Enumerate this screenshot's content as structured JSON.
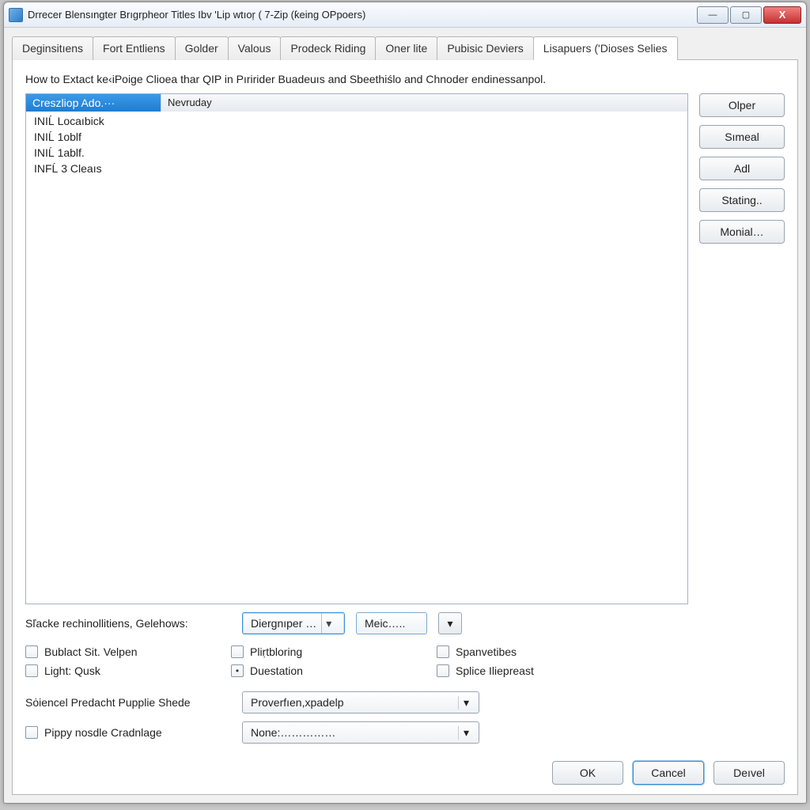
{
  "window": {
    "title": "Drrecer Blensıngter Brıgrpheor Titles Ibv 'Lip wtıoŗ ( 7-Zip (ƙeing OPpoers)"
  },
  "tabs": [
    "Deginsitıens",
    "Fort Entliens",
    "Golder",
    "Valous",
    "Prodeck Riding",
    "Oner lite",
    "Pubisic Deviers",
    "Lisapuers ('Dioses Selies"
  ],
  "active_tab_index": 7,
  "description": "How to Extact ke‹iPoige Clioea thar QIP in Pıririder Buadeuıs and Sbeethiślo and Chnoder endinessanpol.",
  "list": {
    "header_col1": "Creszliop Ado.···",
    "header_col2": "Nevruday",
    "rows": [
      "INIĹ Locaıbick",
      "INIĹ 1oblf",
      "INIĹ 1ablf.",
      "INFĹ 3 Cleaıs"
    ]
  },
  "side_buttons": [
    "Olper",
    "Sımeal",
    "Adl",
    "Stating..",
    "Monial…"
  ],
  "combo_row": {
    "label": "Sľacke rechinollitiens, Gelehows:",
    "combo1": "Diergnıper …",
    "btn2": "Meic….."
  },
  "checks": [
    {
      "label": "Bublact Sit. Velpen",
      "state": "unchecked"
    },
    {
      "label": "Pliṛtbloring",
      "state": "unchecked"
    },
    {
      "label": "Spanvetibes",
      "state": "unchecked"
    },
    {
      "label": "Light: Qusk",
      "state": "unchecked"
    },
    {
      "label": "Duestation",
      "state": "dot"
    },
    {
      "label": "Splice Iliepreast",
      "state": "unchecked"
    }
  ],
  "row_science": {
    "label": "Sȯiencel Predacht Pupplie Shede",
    "value": "Proverfıen,xpadelp"
  },
  "row_pippy": {
    "label": "Pippy nosdle Cradnlage",
    "value": "None:……………"
  },
  "footer": {
    "ok": "OK",
    "cancel": "Cancel",
    "dervel": "Deıvel"
  }
}
